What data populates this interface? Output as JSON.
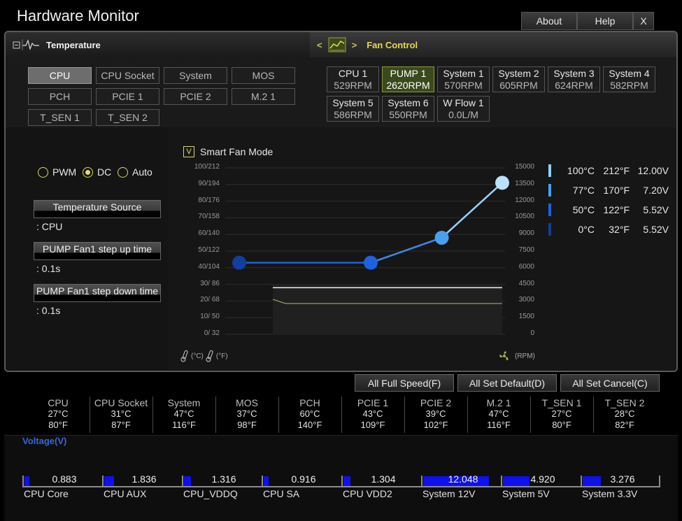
{
  "window": {
    "title": "Hardware Monitor",
    "about": "About",
    "help": "Help",
    "close": "X"
  },
  "temp_panel": {
    "title": "Temperature",
    "sources": [
      "CPU",
      "CPU Socket",
      "System",
      "MOS",
      "PCH",
      "PCIE 1",
      "PCIE 2",
      "M.2 1",
      "T_SEN 1",
      "T_SEN 2"
    ],
    "selected": "CPU"
  },
  "fan_panel": {
    "title": "Fan Control",
    "nav_left": "<",
    "nav_right": ">",
    "fans": [
      {
        "name": "CPU 1",
        "rpm": "529RPM"
      },
      {
        "name": "PUMP 1",
        "rpm": "2620RPM"
      },
      {
        "name": "System 1",
        "rpm": "570RPM"
      },
      {
        "name": "System 2",
        "rpm": "605RPM"
      },
      {
        "name": "System 3",
        "rpm": "624RPM"
      },
      {
        "name": "System 4",
        "rpm": "582RPM"
      },
      {
        "name": "System 5",
        "rpm": "586RPM"
      },
      {
        "name": "System 6",
        "rpm": "550RPM"
      },
      {
        "name": "W Flow 1",
        "rpm": "0.0L/M"
      }
    ],
    "selected": "PUMP 1"
  },
  "mode": {
    "pwm": "PWM",
    "dc": "DC",
    "auto": "Auto",
    "selected": "DC",
    "smart_fan": "Smart Fan Mode",
    "smart_fan_check": "V"
  },
  "settings": {
    "temp_source_label": "Temperature Source",
    "temp_source_value": ": CPU",
    "step_up_label": "PUMP Fan1 step up time",
    "step_up_value": ": 0.1s",
    "step_down_label": "PUMP Fan1 step down time",
    "step_down_value": ": 0.1s"
  },
  "chart_data": {
    "type": "line",
    "left_ticks": [
      "100/212",
      "90/194",
      "80/176",
      "70/158",
      "60/140",
      "50/122",
      "40/104",
      "30/ 86",
      "20/ 68",
      "10/ 50",
      "0/ 32"
    ],
    "right_ticks": [
      "15000",
      "13500",
      "12000",
      "10500",
      "9000",
      "7500",
      "6000",
      "4500",
      "3000",
      "1500",
      "0"
    ],
    "x_unit_c": "(°C)",
    "x_unit_f": "(°F)",
    "rpm_unit": "(RPM)",
    "points": [
      {
        "temp_c": 0,
        "pct": 43
      },
      {
        "temp_c": 50,
        "pct": 43
      },
      {
        "temp_c": 77,
        "pct": 58
      },
      {
        "temp_c": 100,
        "pct": 91
      }
    ],
    "xlim": [
      0,
      100
    ],
    "ylim": [
      0,
      100
    ],
    "legend": [
      {
        "c": "100°C",
        "f": "212°F",
        "v": "12.00V",
        "color": "#8fd0ff"
      },
      {
        "c": "77°C",
        "f": "170°F",
        "v": "7.20V",
        "color": "#4aa0ee"
      },
      {
        "c": "50°C",
        "f": "122°F",
        "v": "5.52V",
        "color": "#1f62e0"
      },
      {
        "c": "0°C",
        "f": "32°F",
        "v": "5.52V",
        "color": "#123e9c"
      }
    ]
  },
  "actions": {
    "full_speed": "All Full Speed(F)",
    "set_default": "All Set Default(D)",
    "set_cancel": "All Set Cancel(C)"
  },
  "temperatures": [
    {
      "name": "CPU",
      "c": "27°C",
      "f": "80°F"
    },
    {
      "name": "CPU Socket",
      "c": "31°C",
      "f": "87°F"
    },
    {
      "name": "System",
      "c": "47°C",
      "f": "116°F"
    },
    {
      "name": "MOS",
      "c": "37°C",
      "f": "98°F"
    },
    {
      "name": "PCH",
      "c": "60°C",
      "f": "140°F"
    },
    {
      "name": "PCIE 1",
      "c": "43°C",
      "f": "109°F"
    },
    {
      "name": "PCIE 2",
      "c": "39°C",
      "f": "102°F"
    },
    {
      "name": "M.2 1",
      "c": "47°C",
      "f": "116°F"
    },
    {
      "name": "T_SEN 1",
      "c": "27°C",
      "f": "80°F"
    },
    {
      "name": "T_SEN 2",
      "c": "28°C",
      "f": "82°F"
    }
  ],
  "voltage": {
    "title": "Voltage(V)",
    "items": [
      {
        "name": "CPU Core",
        "value": "0.883",
        "level": 0.07
      },
      {
        "name": "CPU AUX",
        "value": "1.836",
        "level": 0.15
      },
      {
        "name": "CPU_VDDQ",
        "value": "1.316",
        "level": 0.1
      },
      {
        "name": "CPU SA",
        "value": "0.916",
        "level": 0.07
      },
      {
        "name": "CPU VDD2",
        "value": "1.304",
        "level": 0.1
      },
      {
        "name": "System 12V",
        "value": "12.048",
        "level": 0.98
      },
      {
        "name": "System 5V",
        "value": "4.920",
        "level": 0.4
      },
      {
        "name": "System 3.3V",
        "value": "3.276",
        "level": 0.27
      }
    ]
  }
}
